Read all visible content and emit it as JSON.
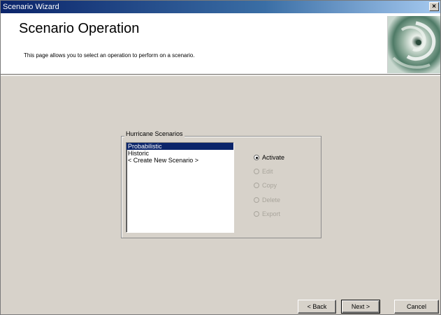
{
  "window": {
    "title": "Scenario Wizard",
    "close_label": "×"
  },
  "header": {
    "title": "Scenario Operation",
    "description": "This page allows you to select an operation to perform on a scenario.",
    "image_icon": "hurricane-satellite-image"
  },
  "scenarios": {
    "group_label": "Hurricane Scenarios",
    "items": [
      {
        "label": "Probabilistic",
        "selected": true
      },
      {
        "label": "Historic",
        "selected": false
      },
      {
        "label": "< Create New Scenario >",
        "selected": false
      }
    ]
  },
  "operations": [
    {
      "label": "Activate",
      "checked": true,
      "enabled": true
    },
    {
      "label": "Edit",
      "checked": false,
      "enabled": false
    },
    {
      "label": "Copy",
      "checked": false,
      "enabled": false
    },
    {
      "label": "Delete",
      "checked": false,
      "enabled": false
    },
    {
      "label": "Export",
      "checked": false,
      "enabled": false
    }
  ],
  "buttons": {
    "back": "< Back",
    "next": "Next >",
    "cancel": "Cancel"
  },
  "colors": {
    "titlebar_start": "#0b246a",
    "selection": "#0a246a",
    "dialog_background": "#d7d2ca",
    "disabled_text": "#a9a59c"
  }
}
